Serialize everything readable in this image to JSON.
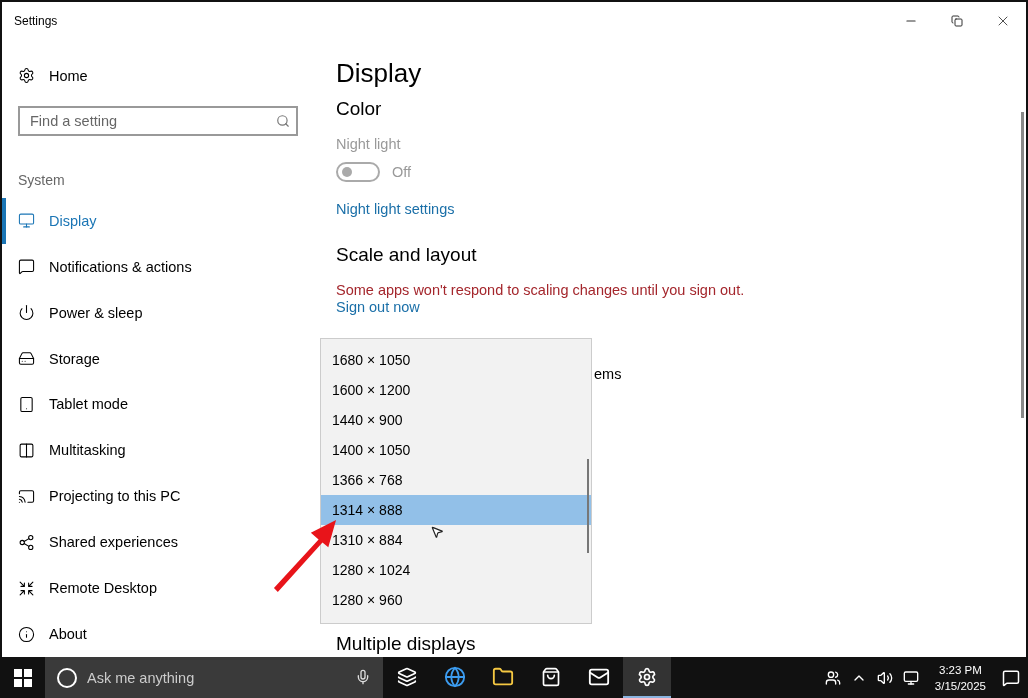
{
  "window": {
    "title": "Settings"
  },
  "sidebar": {
    "home": "Home",
    "search": {
      "placeholder": "Find a setting"
    },
    "section": "System",
    "items": [
      {
        "label": "Display",
        "selected": true
      },
      {
        "label": "Notifications & actions",
        "selected": false
      },
      {
        "label": "Power & sleep",
        "selected": false
      },
      {
        "label": "Storage",
        "selected": false
      },
      {
        "label": "Tablet mode",
        "selected": false
      },
      {
        "label": "Multitasking",
        "selected": false
      },
      {
        "label": "Projecting to this PC",
        "selected": false
      },
      {
        "label": "Shared experiences",
        "selected": false
      },
      {
        "label": "Remote Desktop",
        "selected": false
      },
      {
        "label": "About",
        "selected": false
      }
    ]
  },
  "content": {
    "title": "Display",
    "color_heading": "Color",
    "night_light": {
      "label": "Night light",
      "on": false,
      "disabled": true,
      "state_text": "Off"
    },
    "night_light_link": "Night light settings",
    "scale_heading": "Scale and layout",
    "warning": "Some apps won't respond to scaling changes until you sign out.",
    "sign_out_link": "Sign out now",
    "partial_text": "ems",
    "resolution_options": [
      {
        "label": "1680 × 1050",
        "selected": false
      },
      {
        "label": "1600 × 1200",
        "selected": false
      },
      {
        "label": "1440 × 900",
        "selected": false
      },
      {
        "label": "1400 × 1050",
        "selected": false
      },
      {
        "label": "1366 × 768",
        "selected": false
      },
      {
        "label": "1314 × 888",
        "selected": true
      },
      {
        "label": "1310 × 884",
        "selected": false
      },
      {
        "label": "1280 × 1024",
        "selected": false
      },
      {
        "label": "1280 × 960",
        "selected": false
      }
    ],
    "multiple_heading": "Multiple displays"
  },
  "taskbar": {
    "search": {
      "placeholder": "Ask me anything"
    },
    "apps": [
      {
        "kind": "taskview",
        "selected": false
      },
      {
        "kind": "browser",
        "selected": false
      },
      {
        "kind": "folder",
        "selected": false
      },
      {
        "kind": "store",
        "selected": false
      },
      {
        "kind": "mail",
        "selected": false
      },
      {
        "kind": "settings",
        "selected": true
      }
    ],
    "time": "3:23 PM",
    "date": "3/15/2025"
  }
}
